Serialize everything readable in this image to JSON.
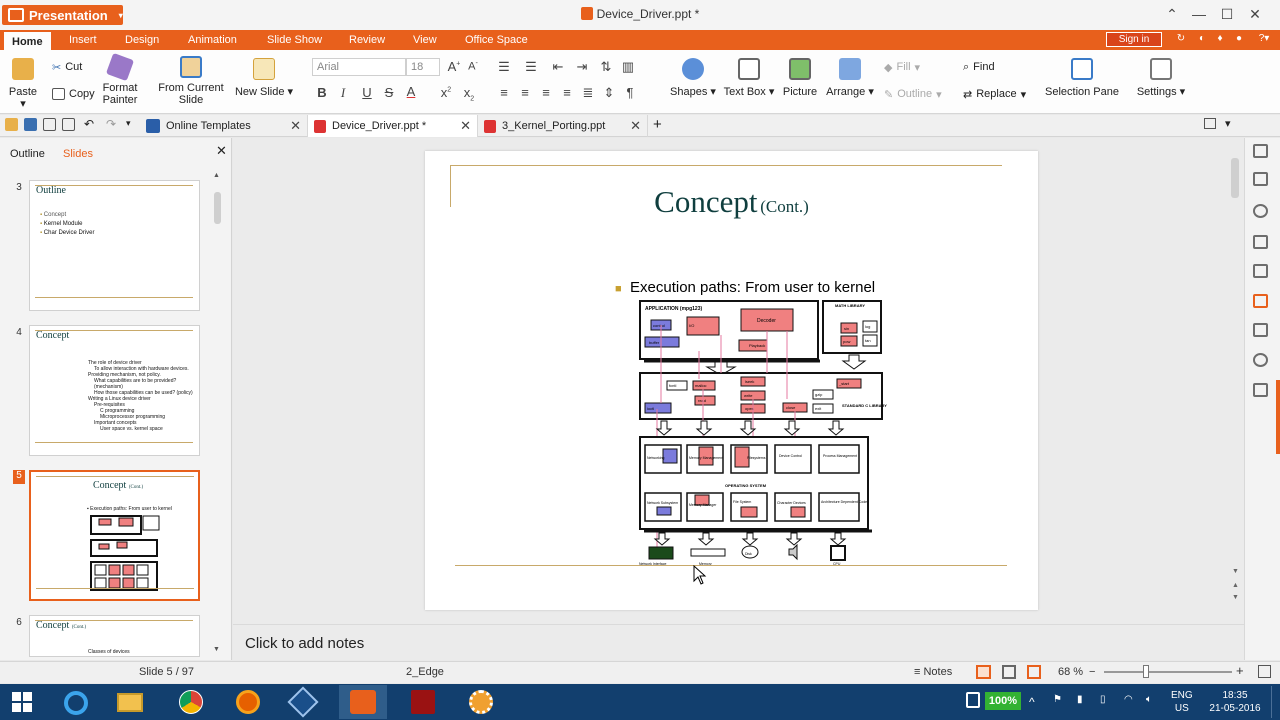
{
  "app": {
    "name": "Presentation",
    "document_title": "Device_Driver.ppt *"
  },
  "menu": {
    "tabs": [
      "Home",
      "Insert",
      "Design",
      "Animation",
      "Slide Show",
      "Review",
      "View",
      "Office Space"
    ],
    "active": "Home",
    "sign_in": "Sign in"
  },
  "ribbon": {
    "paste": "Paste",
    "cut": "Cut",
    "copy": "Copy",
    "format_painter_1": "Format",
    "format_painter_2": "Painter",
    "from_current_1": "From Current",
    "from_current_2": "Slide",
    "new_slide": "New Slide",
    "font_name": "Arial",
    "font_size": "18",
    "shapes": "Shapes",
    "text_box": "Text Box",
    "picture": "Picture",
    "arrange": "Arrange",
    "fill": "Fill",
    "outline": "Outline",
    "find": "Find",
    "replace": "Replace",
    "selection_pane": "Selection Pane",
    "settings": "Settings"
  },
  "doc_tabs": [
    {
      "label": "Online Templates",
      "active": false
    },
    {
      "label": "Device_Driver.ppt *",
      "active": true
    },
    {
      "label": "3_Kernel_Porting.ppt",
      "active": false
    }
  ],
  "panel": {
    "tab_outline": "Outline",
    "tab_slides": "Slides",
    "active_tab": "Slides"
  },
  "thumbnails": [
    {
      "num": "3",
      "title": "Outline",
      "bullets": [
        "Concept",
        "Kernel Module",
        "Char Device Driver"
      ]
    },
    {
      "num": "4",
      "title": "Concept",
      "bullets": [
        "The role of device driver",
        "To allow interaction with hardware devices.",
        "Providing mechanism, not policy.",
        "What capabilities are to be provided? (mechanism)",
        "How those capabilities can be used? (policy)",
        "Writing a Linux device driver",
        "Pre-requisites",
        "C programming",
        "Microprocessor programming",
        "Important concepts",
        "User space vs. kernel space"
      ]
    },
    {
      "num": "5",
      "title": "Concept",
      "title_small": "(Cont.)",
      "bullets": [
        "Execution paths: From user to kernel"
      ]
    },
    {
      "num": "6",
      "title": "Concept",
      "title_small": "(Cont.)",
      "bullets": [
        "Classes of devices"
      ]
    }
  ],
  "slide": {
    "title": "Concept",
    "title_small": "(Cont.)",
    "bullet": "Execution paths: From user to kernel",
    "diagram": {
      "app_label": "APPLICATION (mpg123)",
      "math_label": "MATH LIBRARY",
      "stdc_label": "STANDARD C LIBRARY",
      "os_label": "OPERATING SYSTEM",
      "app_boxes": [
        "control",
        "buffer",
        "Decoder",
        "Playback",
        "I/O"
      ],
      "math_boxes": [
        "sin",
        "log",
        "pow",
        "tan"
      ],
      "lib_boxes": [
        "ioctl",
        "fcntl",
        "malloc",
        "lseek",
        "read",
        "write",
        "_start",
        "open",
        "close",
        "gzip",
        "exit"
      ],
      "os_row1": [
        "Networking",
        "Memory Management",
        "Filesystems",
        "Device Control",
        "Process Management"
      ],
      "os_row2": [
        "Network Subsystem",
        "Memory Manager",
        "File System",
        "Character Devices",
        "Architecture Dependent Code"
      ],
      "hw_labels": [
        "Network Interface",
        "Memory",
        "Disk",
        "Speaker",
        "CPU"
      ]
    }
  },
  "notes_placeholder": "Click to add notes",
  "status": {
    "slide": "Slide 5 / 97",
    "theme": "2_Edge",
    "notes": "Notes",
    "zoom": "68 %"
  },
  "taskbar": {
    "battery": "100%",
    "lang_1": "ENG",
    "lang_2": "US",
    "time": "18:35",
    "date": "21-05-2016"
  },
  "colors": {
    "accent": "#e8601c",
    "slide_title": "#0f3e3e",
    "diagram_red": "#f08080",
    "diagram_blue": "#7b7bdc"
  }
}
